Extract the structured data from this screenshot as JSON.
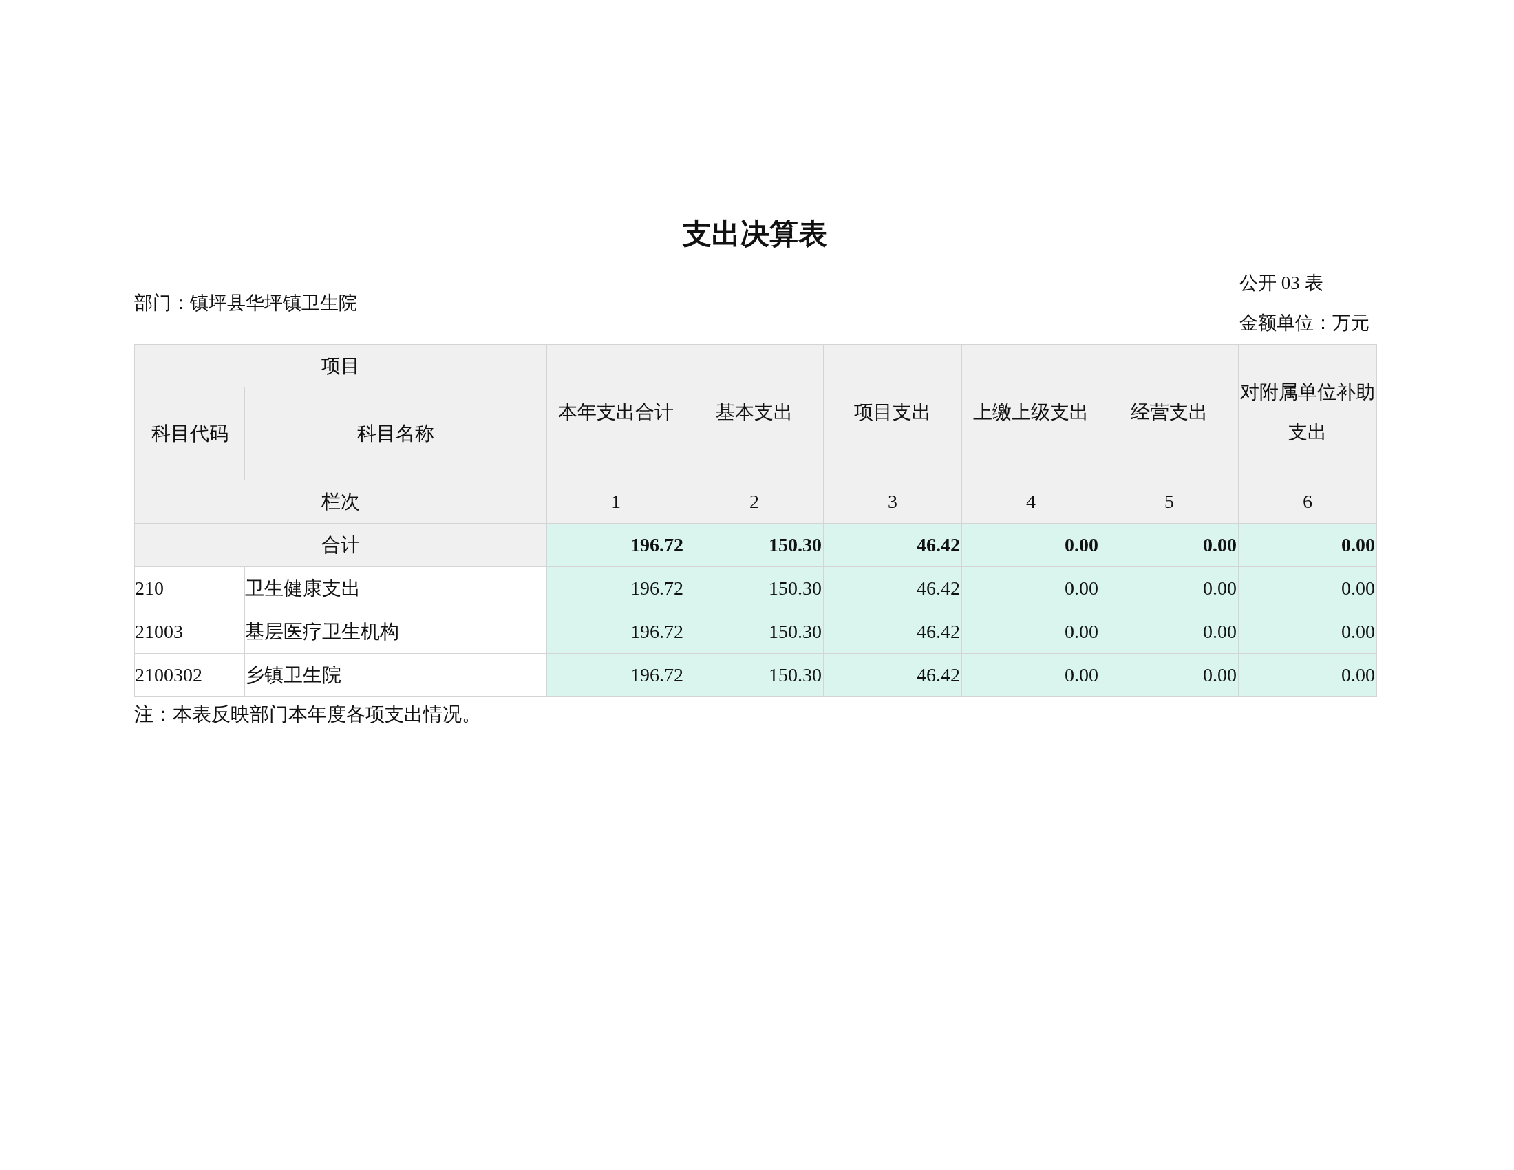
{
  "title": "支出决算表",
  "department": "部门：镇坪县华坪镇卫生院",
  "table_no": "公开 03 表",
  "unit": "金额单位：万元",
  "header": {
    "group": "项目",
    "code": "科目代码",
    "name": "科目名称",
    "columns": [
      "本年支出合计",
      "基本支出",
      "项目支出",
      "上缴上级支出",
      "经营支出",
      "对附属单位补助支出"
    ]
  },
  "index_row": {
    "label": "栏次",
    "numbers": [
      "1",
      "2",
      "3",
      "4",
      "5",
      "6"
    ]
  },
  "rows": [
    {
      "kind": "total",
      "label": "合计",
      "values": [
        "196.72",
        "150.30",
        "46.42",
        "0.00",
        "0.00",
        "0.00"
      ]
    },
    {
      "kind": "item",
      "code": "210",
      "name": "卫生健康支出",
      "values": [
        "196.72",
        "150.30",
        "46.42",
        "0.00",
        "0.00",
        "0.00"
      ]
    },
    {
      "kind": "item",
      "code": "21003",
      "name": "基层医疗卫生机构",
      "values": [
        "196.72",
        "150.30",
        "46.42",
        "0.00",
        "0.00",
        "0.00"
      ]
    },
    {
      "kind": "item",
      "code": "2100302",
      "name": "乡镇卫生院",
      "values": [
        "196.72",
        "150.30",
        "46.42",
        "0.00",
        "0.00",
        "0.00"
      ]
    }
  ],
  "note": "注：本表反映部门本年度各项支出情况。"
}
